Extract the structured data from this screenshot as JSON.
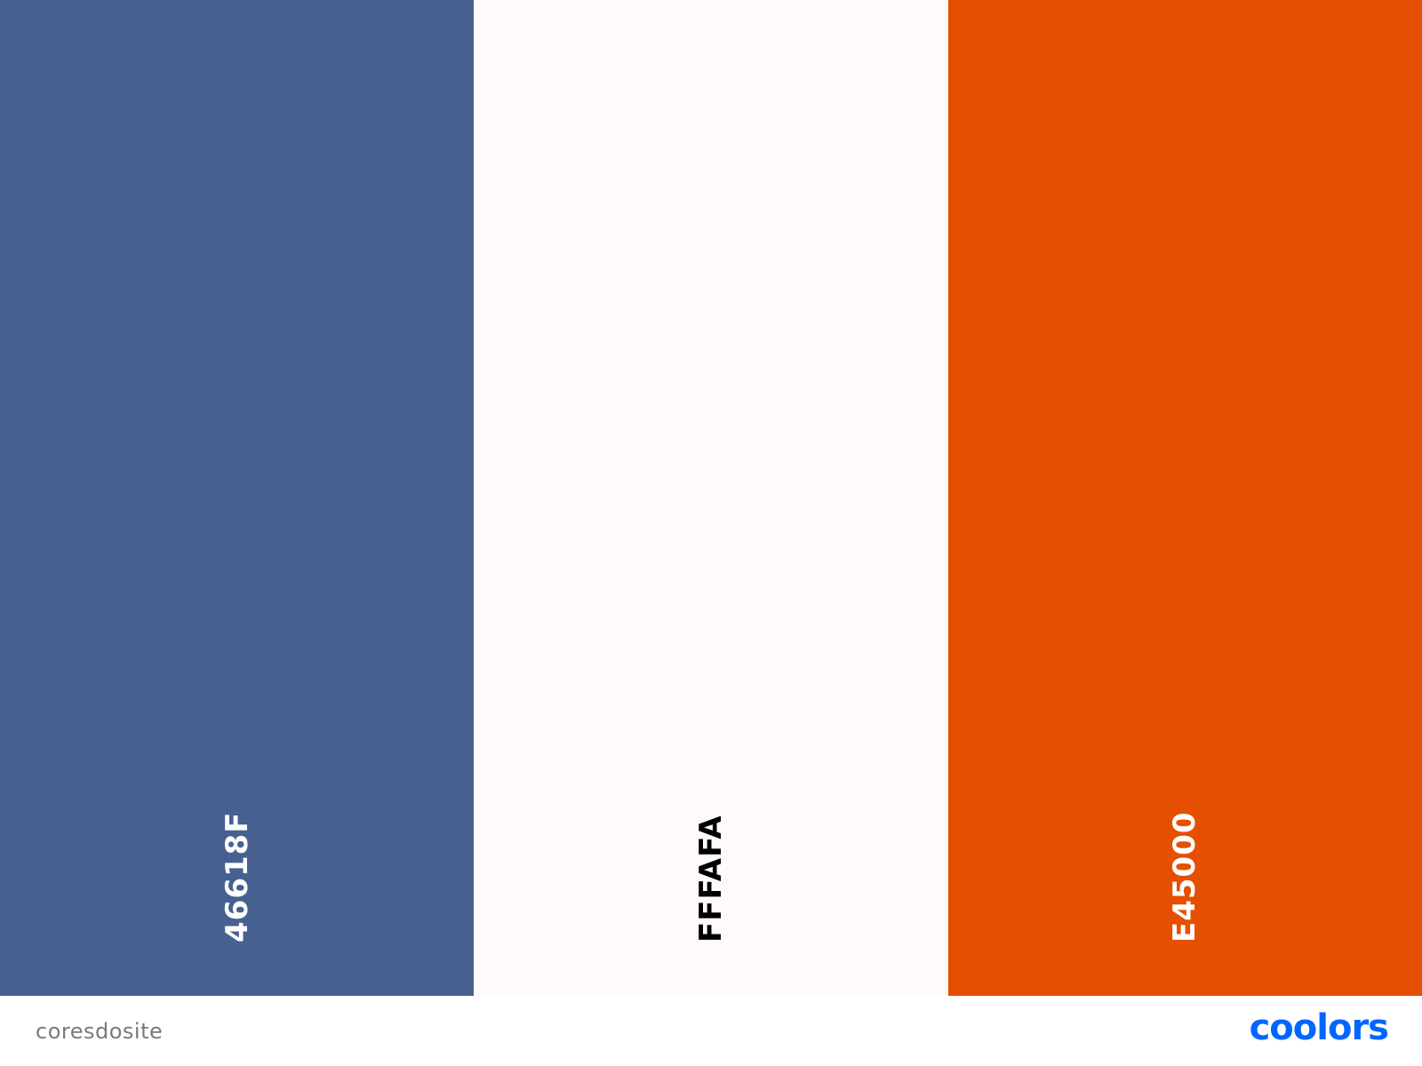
{
  "palette": {
    "swatches": [
      {
        "hex": "46618F",
        "color": "#46618F",
        "text_color": "#FFFFFF"
      },
      {
        "hex": "FFFAFA",
        "color": "#FFFAFA",
        "text_color": "#000000"
      },
      {
        "hex": "E45000",
        "color": "#E45000",
        "text_color": "#FFFFFF"
      }
    ]
  },
  "footer": {
    "palette_name": "coresdosite",
    "brand_name": "coolors",
    "brand_color": "#0066FF",
    "palette_name_color": "#7A7A7A"
  }
}
